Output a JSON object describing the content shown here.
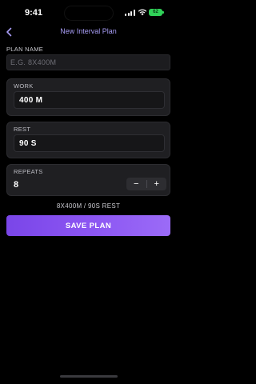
{
  "status_bar": {
    "time": "9:41",
    "battery_label": "62",
    "battery_color": "#30d158"
  },
  "nav": {
    "title": "New Interval Plan",
    "back_icon": "chevron-left-icon"
  },
  "plan_name": {
    "label": "PLAN NAME",
    "value": "",
    "placeholder": "E.G. 8X400M"
  },
  "work": {
    "label": "WORK",
    "value": "400 M"
  },
  "rest": {
    "label": "REST",
    "value": "90 S"
  },
  "repeats": {
    "label": "REPEATS",
    "value": "8",
    "decrement": "−",
    "increment": "+"
  },
  "summary": "8X400M / 90S REST",
  "save_button": {
    "label": "SAVE PLAN"
  },
  "colors": {
    "accent": "#8b55f2",
    "nav_title": "#a79cf5",
    "background": "#000000",
    "card": "#1f1f22"
  }
}
